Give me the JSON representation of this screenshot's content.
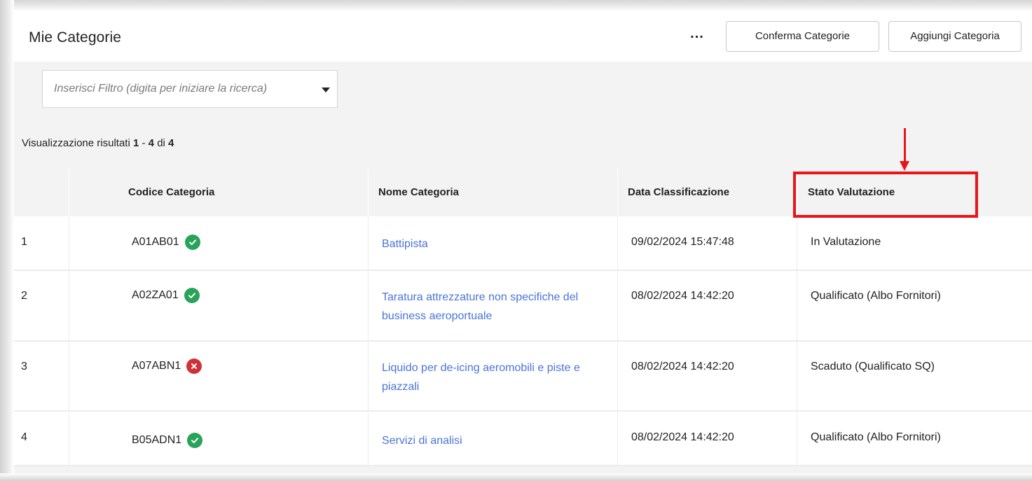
{
  "header": {
    "title": "Mie Categorie",
    "more_label": "...",
    "confirm_label": "Conferma Categorie",
    "add_label": "Aggiungi Categoria"
  },
  "filter": {
    "placeholder": "Inserisci Filtro (digita per iniziare la ricerca)",
    "value": ""
  },
  "results": {
    "prefix": "Visualizzazione risultati",
    "from": "1",
    "sep": "-",
    "to": "4",
    "of": "di",
    "total": "4"
  },
  "table": {
    "columns": {
      "code": "Codice Categoria",
      "name": "Nome Categoria",
      "date": "Data Classificazione",
      "status": "Stato Valutazione"
    },
    "rows": [
      {
        "index": "1",
        "code": "A01AB01",
        "status_icon": "check-icon",
        "name": "Battipista",
        "date": "09/02/2024 15:47:48",
        "status": "In Valutazione"
      },
      {
        "index": "2",
        "code": "A02ZA01",
        "status_icon": "check-icon",
        "name": "Taratura attrezzature non specifiche del business aeroportuale",
        "date": "08/02/2024 14:42:20",
        "status": "Qualificato (Albo Fornitori)"
      },
      {
        "index": "3",
        "code": "A07ABN1",
        "status_icon": "cross-icon",
        "name": "Liquido per de-icing aeromobili e piste e piazzali",
        "date": "08/02/2024 14:42:20",
        "status": "Scaduto (Qualificato SQ)"
      },
      {
        "index": "4",
        "code": "B05ADN1",
        "status_icon": "check-icon",
        "name": "Servizi di analisi",
        "date": "08/02/2024 14:42:20",
        "status": "Qualificato (Albo Fornitori)"
      }
    ]
  },
  "colors": {
    "link": "#4a74d9",
    "ok": "#28a35a",
    "error": "#cf3236",
    "annotation": "#e8151b"
  }
}
